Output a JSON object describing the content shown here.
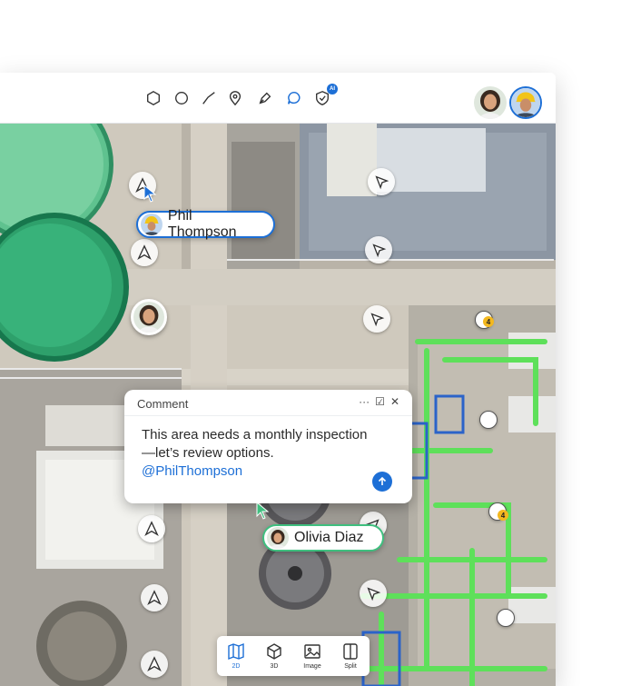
{
  "toolbar": {
    "tools": [
      {
        "name": "hexagon-icon",
        "active": false
      },
      {
        "name": "circle-icon",
        "active": false
      },
      {
        "name": "line-icon",
        "active": false
      },
      {
        "name": "pin-icon",
        "active": false
      },
      {
        "name": "pen-icon",
        "active": false
      },
      {
        "name": "comment-icon",
        "active": true
      },
      {
        "name": "ai-shield-icon",
        "active": false
      }
    ],
    "ai_badge": "AI",
    "avatars": [
      "woman-avatar",
      "man-hardhat-avatar"
    ]
  },
  "collaborators": {
    "phil": {
      "name": "Phil Thompson"
    },
    "olivia": {
      "name": "Olivia Diaz"
    }
  },
  "comment": {
    "header": "Comment",
    "more": "···",
    "resolve": "☑",
    "close": "✕",
    "text": "This area needs a monthly inspection—let’s review options.",
    "mention": "@PhilThompson"
  },
  "badges": [
    "4",
    "4"
  ],
  "view_modes": [
    {
      "label": "2D",
      "icon": "map-icon",
      "active": true
    },
    {
      "label": "3D",
      "icon": "cube-icon",
      "active": false
    },
    {
      "label": "Image",
      "icon": "image-icon",
      "active": false
    },
    {
      "label": "Split",
      "icon": "split-icon",
      "active": false
    }
  ],
  "colors": {
    "accent": "#1d6fd6",
    "olivia_tag_border": "#3fbf7f",
    "phil_tag_border": "#1d6fd6",
    "badge": "#f3b81f"
  }
}
